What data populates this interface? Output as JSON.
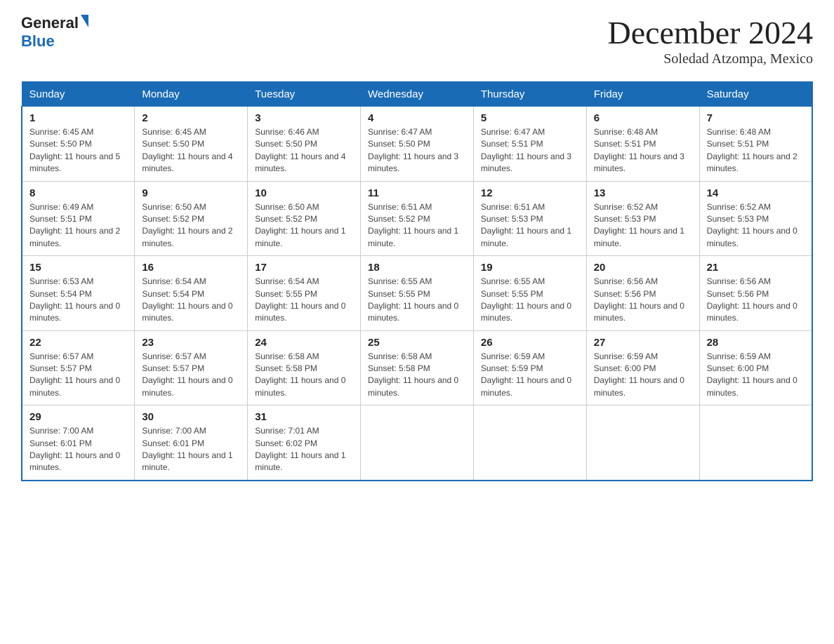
{
  "header": {
    "logo_general": "General",
    "logo_blue": "Blue",
    "title": "December 2024",
    "subtitle": "Soledad Atzompa, Mexico"
  },
  "weekdays": [
    "Sunday",
    "Monday",
    "Tuesday",
    "Wednesday",
    "Thursday",
    "Friday",
    "Saturday"
  ],
  "weeks": [
    [
      {
        "day": "1",
        "sunrise": "6:45 AM",
        "sunset": "5:50 PM",
        "daylight": "11 hours and 5 minutes."
      },
      {
        "day": "2",
        "sunrise": "6:45 AM",
        "sunset": "5:50 PM",
        "daylight": "11 hours and 4 minutes."
      },
      {
        "day": "3",
        "sunrise": "6:46 AM",
        "sunset": "5:50 PM",
        "daylight": "11 hours and 4 minutes."
      },
      {
        "day": "4",
        "sunrise": "6:47 AM",
        "sunset": "5:50 PM",
        "daylight": "11 hours and 3 minutes."
      },
      {
        "day": "5",
        "sunrise": "6:47 AM",
        "sunset": "5:51 PM",
        "daylight": "11 hours and 3 minutes."
      },
      {
        "day": "6",
        "sunrise": "6:48 AM",
        "sunset": "5:51 PM",
        "daylight": "11 hours and 3 minutes."
      },
      {
        "day": "7",
        "sunrise": "6:48 AM",
        "sunset": "5:51 PM",
        "daylight": "11 hours and 2 minutes."
      }
    ],
    [
      {
        "day": "8",
        "sunrise": "6:49 AM",
        "sunset": "5:51 PM",
        "daylight": "11 hours and 2 minutes."
      },
      {
        "day": "9",
        "sunrise": "6:50 AM",
        "sunset": "5:52 PM",
        "daylight": "11 hours and 2 minutes."
      },
      {
        "day": "10",
        "sunrise": "6:50 AM",
        "sunset": "5:52 PM",
        "daylight": "11 hours and 1 minute."
      },
      {
        "day": "11",
        "sunrise": "6:51 AM",
        "sunset": "5:52 PM",
        "daylight": "11 hours and 1 minute."
      },
      {
        "day": "12",
        "sunrise": "6:51 AM",
        "sunset": "5:53 PM",
        "daylight": "11 hours and 1 minute."
      },
      {
        "day": "13",
        "sunrise": "6:52 AM",
        "sunset": "5:53 PM",
        "daylight": "11 hours and 1 minute."
      },
      {
        "day": "14",
        "sunrise": "6:52 AM",
        "sunset": "5:53 PM",
        "daylight": "11 hours and 0 minutes."
      }
    ],
    [
      {
        "day": "15",
        "sunrise": "6:53 AM",
        "sunset": "5:54 PM",
        "daylight": "11 hours and 0 minutes."
      },
      {
        "day": "16",
        "sunrise": "6:54 AM",
        "sunset": "5:54 PM",
        "daylight": "11 hours and 0 minutes."
      },
      {
        "day": "17",
        "sunrise": "6:54 AM",
        "sunset": "5:55 PM",
        "daylight": "11 hours and 0 minutes."
      },
      {
        "day": "18",
        "sunrise": "6:55 AM",
        "sunset": "5:55 PM",
        "daylight": "11 hours and 0 minutes."
      },
      {
        "day": "19",
        "sunrise": "6:55 AM",
        "sunset": "5:55 PM",
        "daylight": "11 hours and 0 minutes."
      },
      {
        "day": "20",
        "sunrise": "6:56 AM",
        "sunset": "5:56 PM",
        "daylight": "11 hours and 0 minutes."
      },
      {
        "day": "21",
        "sunrise": "6:56 AM",
        "sunset": "5:56 PM",
        "daylight": "11 hours and 0 minutes."
      }
    ],
    [
      {
        "day": "22",
        "sunrise": "6:57 AM",
        "sunset": "5:57 PM",
        "daylight": "11 hours and 0 minutes."
      },
      {
        "day": "23",
        "sunrise": "6:57 AM",
        "sunset": "5:57 PM",
        "daylight": "11 hours and 0 minutes."
      },
      {
        "day": "24",
        "sunrise": "6:58 AM",
        "sunset": "5:58 PM",
        "daylight": "11 hours and 0 minutes."
      },
      {
        "day": "25",
        "sunrise": "6:58 AM",
        "sunset": "5:58 PM",
        "daylight": "11 hours and 0 minutes."
      },
      {
        "day": "26",
        "sunrise": "6:59 AM",
        "sunset": "5:59 PM",
        "daylight": "11 hours and 0 minutes."
      },
      {
        "day": "27",
        "sunrise": "6:59 AM",
        "sunset": "6:00 PM",
        "daylight": "11 hours and 0 minutes."
      },
      {
        "day": "28",
        "sunrise": "6:59 AM",
        "sunset": "6:00 PM",
        "daylight": "11 hours and 0 minutes."
      }
    ],
    [
      {
        "day": "29",
        "sunrise": "7:00 AM",
        "sunset": "6:01 PM",
        "daylight": "11 hours and 0 minutes."
      },
      {
        "day": "30",
        "sunrise": "7:00 AM",
        "sunset": "6:01 PM",
        "daylight": "11 hours and 1 minute."
      },
      {
        "day": "31",
        "sunrise": "7:01 AM",
        "sunset": "6:02 PM",
        "daylight": "11 hours and 1 minute."
      },
      {
        "day": "",
        "sunrise": "",
        "sunset": "",
        "daylight": ""
      },
      {
        "day": "",
        "sunrise": "",
        "sunset": "",
        "daylight": ""
      },
      {
        "day": "",
        "sunrise": "",
        "sunset": "",
        "daylight": ""
      },
      {
        "day": "",
        "sunrise": "",
        "sunset": "",
        "daylight": ""
      }
    ]
  ],
  "labels": {
    "sunrise": "Sunrise:",
    "sunset": "Sunset:",
    "daylight": "Daylight:"
  }
}
